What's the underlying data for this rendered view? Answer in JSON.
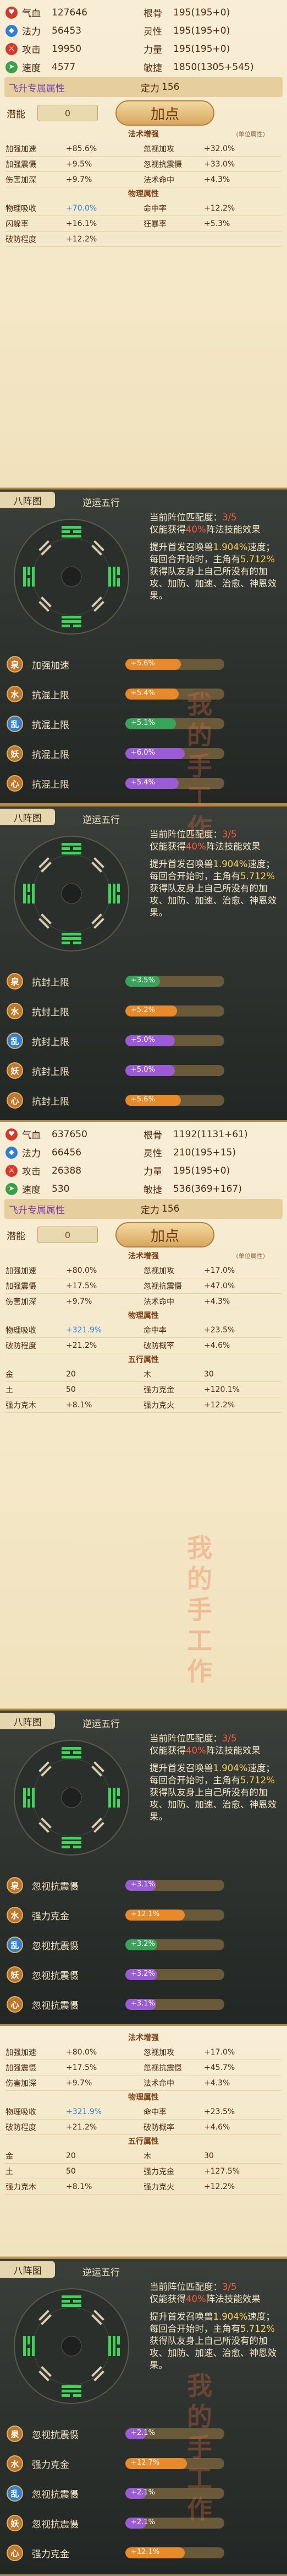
{
  "watermark": [
    "我",
    "的",
    "手",
    "工",
    "作"
  ],
  "labels": {
    "hp": "气血",
    "mp": "法力",
    "atk": "攻击",
    "spd": "速度",
    "gengu": "根骨",
    "lingxing": "灵性",
    "liliang": "力量",
    "minjie": "敏捷",
    "fly": "飞升专属属性",
    "dingli": "定力",
    "potential": "潜能",
    "add": "加点",
    "fashu": "法术增强",
    "wuli": "物理属性",
    "wuxing": "五行属性",
    "bzt_title": "八阵图",
    "formation": "逆运五行"
  },
  "colors": {
    "hp": "#d6392b",
    "mp": "#2f7fd6",
    "atk": "#d6392b",
    "spd": "#3a9f4a",
    "water": "#2f7fd6",
    "fire": "#d6392b",
    "wood": "#3a9f4a",
    "earth": "#c0762a",
    "metal": "#d9a530",
    "bar_orange": "#e8892a",
    "bar_green": "#3aa35a",
    "bar_purple": "#9b5ad6"
  },
  "char1": {
    "hp": "127646",
    "mp": "56453",
    "atk": "19950",
    "spd": "4577",
    "gengu": "195(195+0)",
    "lingxing": "195(195+0)",
    "liliang": "195(195+0)",
    "minjie": "1850(1305+545)",
    "dingli": "156",
    "potential": "0",
    "fashu_note": "(单位属性)",
    "fashu": [
      [
        "加强加速",
        "+85.6%",
        "忽视加攻",
        "+32.0%"
      ],
      [
        "加强震慑",
        "+9.5%",
        "忽视抗震慑",
        "+33.0%"
      ],
      [
        "伤害加深",
        "+9.7%",
        "法术命中",
        "+4.3%"
      ]
    ],
    "wuli": [
      [
        "物理吸收",
        "+70.0%",
        "命中率",
        "+12.2%"
      ],
      [
        "闪躲率",
        "+16.1%",
        "狂暴率",
        "+5.3%"
      ],
      [
        "破防程度",
        "+12.2%",
        "",
        ""
      ]
    ]
  },
  "bzt1": {
    "desc1a": "当前阵位匹配度：",
    "desc1b": "3/5",
    "desc1c": "仅能获得",
    "desc1d": "40%",
    "desc1e": "阵法技能效果",
    "desc2a": "提升首发召唤兽",
    "desc2b": "1.904%",
    "desc2c": "速度；每回合开始时，主角有",
    "desc2d": "5.712%",
    "desc2e": "获得队友身上自己所没有的加攻、加防、加速、治愈、神恩效果。",
    "rows": [
      {
        "elem": "泉",
        "skill": "加强加速",
        "pct": "+5.6%",
        "fill": 0.56,
        "color": "#e8892a"
      },
      {
        "elem": "水",
        "skill": "抗混上限",
        "pct": "+5.4%",
        "fill": 0.54,
        "color": "#e8892a"
      },
      {
        "elem": "乱",
        "skill": "抗混上限",
        "pct": "+5.1%",
        "fill": 0.51,
        "color": "#3aa35a"
      },
      {
        "elem": "妖",
        "skill": "抗混上限",
        "pct": "+6.0%",
        "fill": 0.6,
        "color": "#9b5ad6"
      },
      {
        "elem": "心",
        "skill": "抗混上限",
        "pct": "+5.4%",
        "fill": 0.54,
        "color": "#9b5ad6"
      }
    ]
  },
  "bzt2": {
    "desc1a": "当前阵位匹配度：",
    "desc1b": "3/5",
    "desc1c": "仅能获得",
    "desc1d": "40%",
    "desc1e": "阵法技能效果",
    "desc2a": "提升首发召唤兽",
    "desc2b": "1.904%",
    "desc2c": "速度；每回合开始时，主角有",
    "desc2d": "5.712%",
    "desc2e": "获得队友身上自己所没有的加攻、加防、加速、治愈、神恩效果。",
    "rows": [
      {
        "elem": "泉",
        "skill": "抗封上限",
        "pct": "+3.5%",
        "fill": 0.35,
        "color": "#3aa35a"
      },
      {
        "elem": "水",
        "skill": "抗封上限",
        "pct": "+5.2%",
        "fill": 0.52,
        "color": "#e8892a"
      },
      {
        "elem": "乱",
        "skill": "抗封上限",
        "pct": "+5.0%",
        "fill": 0.5,
        "color": "#9b5ad6"
      },
      {
        "elem": "妖",
        "skill": "抗封上限",
        "pct": "+5.0%",
        "fill": 0.5,
        "color": "#9b5ad6"
      },
      {
        "elem": "心",
        "skill": "抗封上限",
        "pct": "+5.6%",
        "fill": 0.56,
        "color": "#e8892a"
      }
    ]
  },
  "char2": {
    "hp": "637650",
    "mp": "66456",
    "atk": "26388",
    "spd": "530",
    "gengu": "1192(1131+61)",
    "lingxing": "210(195+15)",
    "liliang": "195(195+0)",
    "minjie": "536(369+167)",
    "dingli": "156",
    "potential": "0",
    "fashu_note": "(单位属性)",
    "fashu": [
      [
        "加强加速",
        "+80.0%",
        "忽视加攻",
        "+17.0%"
      ],
      [
        "加强震慑",
        "+17.5%",
        "忽视抗震慑",
        "+47.0%"
      ],
      [
        "伤害加深",
        "+9.7%",
        "法术命中",
        "+4.3%"
      ]
    ],
    "wuli": [
      [
        "物理吸收",
        "+321.9%",
        "命中率",
        "+23.5%"
      ],
      [
        "破防程度",
        "+21.2%",
        "破防概率",
        "+4.6%"
      ]
    ],
    "wuxing": [
      [
        "金",
        "20",
        "木",
        "30"
      ],
      [
        "土",
        "50",
        "强力克金",
        "+120.1%"
      ],
      [
        "强力克木",
        "+8.1%",
        "强力克火",
        "+12.2%"
      ]
    ]
  },
  "bzt3": {
    "desc1a": "当前阵位匹配度：",
    "desc1b": "3/5",
    "desc1c": "仅能获得",
    "desc1d": "40%",
    "desc1e": "阵法技能效果",
    "desc2a": "提升首发召唤兽",
    "desc2b": "1.904%",
    "desc2c": "速度；每回合开始时，主角有",
    "desc2d": "5.712%",
    "desc2e": "获得队友身上自己所没有的加攻、加防、加速、治愈、神恩效果。",
    "rows": [
      {
        "elem": "泉",
        "skill": "忽视抗震慑",
        "pct": "+3.1%",
        "fill": 0.31,
        "color": "#9b5ad6"
      },
      {
        "elem": "水",
        "skill": "强力克金",
        "pct": "+12.1%",
        "fill": 0.6,
        "color": "#e8892a"
      },
      {
        "elem": "乱",
        "skill": "忽视抗震慑",
        "pct": "+3.2%",
        "fill": 0.32,
        "color": "#3aa35a"
      },
      {
        "elem": "妖",
        "skill": "忽视抗震慑",
        "pct": "+3.2%",
        "fill": 0.32,
        "color": "#9b5ad6"
      },
      {
        "elem": "心",
        "skill": "忽视抗震慑",
        "pct": "+3.1%",
        "fill": 0.31,
        "color": "#9b5ad6"
      }
    ]
  },
  "char3": {
    "fashu": [
      [
        "加强加速",
        "+80.0%",
        "忽视加攻",
        "+17.0%"
      ],
      [
        "加强震慑",
        "+17.5%",
        "忽视抗震慑",
        "+45.7%"
      ],
      [
        "伤害加深",
        "+9.7%",
        "法术命中",
        "+4.3%"
      ]
    ],
    "wuli": [
      [
        "物理吸收",
        "+321.9%",
        "命中率",
        "+23.5%"
      ],
      [
        "破防程度",
        "+21.2%",
        "破防概率",
        "+4.6%"
      ]
    ],
    "wuxing": [
      [
        "金",
        "20",
        "木",
        "30"
      ],
      [
        "土",
        "50",
        "强力克金",
        "+127.5%"
      ],
      [
        "强力克木",
        "+8.1%",
        "强力克火",
        "+12.2%"
      ]
    ]
  },
  "bzt4": {
    "desc1a": "当前阵位匹配度：",
    "desc1b": "3/5",
    "desc1c": "仅能获得",
    "desc1d": "40%",
    "desc1e": "阵法技能效果",
    "desc2a": "提升首发召唤兽",
    "desc2b": "1.904%",
    "desc2c": "速度；每回合开始时，主角有",
    "desc2d": "5.712%",
    "desc2e": "获得队友身上自己所没有的加攻、加防、加速、治愈、神恩效果。",
    "rows": [
      {
        "elem": "泉",
        "skill": "忽视抗震慑",
        "pct": "+2.1%",
        "fill": 0.21,
        "color": "#9b5ad6"
      },
      {
        "elem": "水",
        "skill": "强力克金",
        "pct": "+12.7%",
        "fill": 0.62,
        "color": "#e8892a"
      },
      {
        "elem": "乱",
        "skill": "忽视抗震慑",
        "pct": "+2.1%",
        "fill": 0.21,
        "color": "#9b5ad6"
      },
      {
        "elem": "妖",
        "skill": "忽视抗震慑",
        "pct": "+2.1%",
        "fill": 0.21,
        "color": "#9b5ad6"
      },
      {
        "elem": "心",
        "skill": "强力克金",
        "pct": "+12.1%",
        "fill": 0.6,
        "color": "#e8892a"
      }
    ]
  }
}
